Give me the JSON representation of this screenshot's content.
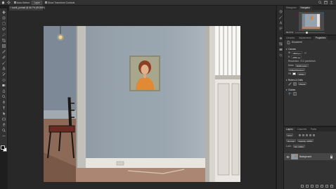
{
  "options_bar": {
    "auto_select_label": "Auto-Select:",
    "auto_select_value": "Layer",
    "transform_label": "Show Transform Controls"
  },
  "document": {
    "tab_title": "sunlit_portrait @ 66.7% (RGB/8*)",
    "close_glyph": "×"
  },
  "navigator": {
    "tabs": [
      "Histogram",
      "Navigator"
    ],
    "active_tab": "Navigator",
    "zoom": "66.67%",
    "zoom_level": 0.35,
    "view_box_color": "#e0282d"
  },
  "properties": {
    "tabs": [
      "Libraries",
      "Adjustments",
      "Properties"
    ],
    "active_tab": "Properties",
    "header": "Document",
    "canvas_section": "Canvas",
    "width_label": "W",
    "width_value": "3823 px",
    "height_label": "H",
    "height_value": "2956 px",
    "resolution": "Resolution: 72.0 pixels/inch",
    "mode_label": "Mode",
    "mode_value": "RGB Color",
    "depth_value": "8 Bits/Channel",
    "fill_label": "Fill",
    "fill_value": "White",
    "rulers_section": "Rulers & Grids",
    "ruler_units": "Pixels",
    "guides_section": "Guides"
  },
  "layers": {
    "tabs": [
      "Layers",
      "Channels",
      "Paths"
    ],
    "active_tab": "Layers",
    "filter_label": "Kind",
    "blend_mode": "Normal",
    "opacity": "Opacity: 100%",
    "lock_label": "Lock:",
    "fill": "Fill: 100%",
    "layer_name": "Background"
  },
  "colors": {
    "accent_red": "#e0282d",
    "wall": "#8f99a3",
    "panel_bg": "#323232",
    "app_bg": "#1e1e1e",
    "foreground": "#0a0a0a",
    "background": "#f4f4f4"
  },
  "icons": {
    "app": "photoshop-home-icon",
    "tools": [
      "move-icon",
      "artboard-icon",
      "marquee-icon",
      "lasso-icon",
      "quick-select-icon",
      "crop-icon",
      "frame-icon",
      "eyedropper-icon",
      "healing-icon",
      "brush-icon",
      "stamp-icon",
      "history-brush-icon",
      "eraser-icon",
      "gradient-icon",
      "blur-icon",
      "dodge-icon",
      "pen-icon",
      "type-icon",
      "path-select-icon",
      "rectangle-icon",
      "hand-icon",
      "zoom-icon",
      "more-tools-icon"
    ]
  }
}
